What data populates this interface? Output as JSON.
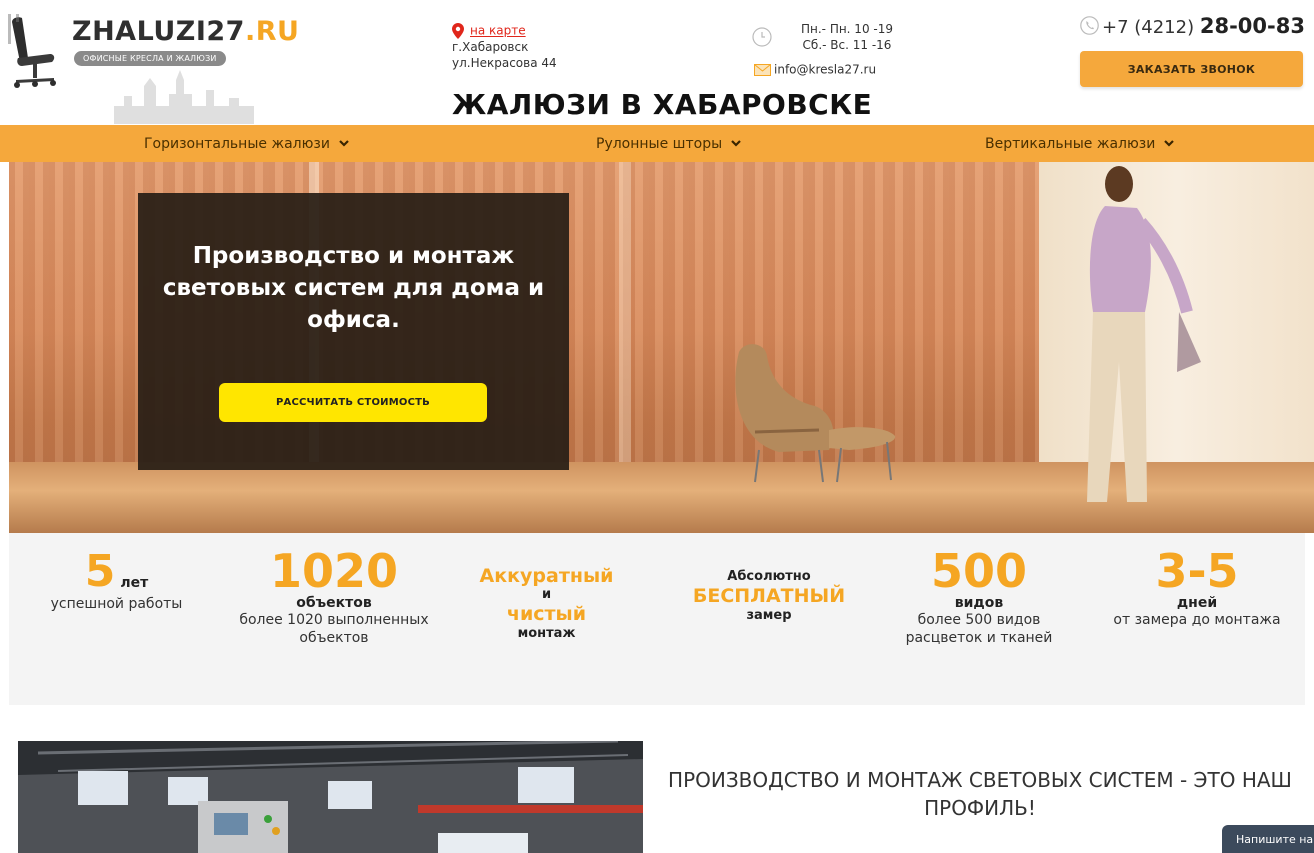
{
  "header": {
    "brand_main": "ZHALUZI27",
    "brand_tld": ".RU",
    "tagline": "ОФИСНЫЕ КРЕСЛА И ЖАЛЮЗИ",
    "map_link": "на карте",
    "address_city": "г.Хабаровск",
    "address_street": "ул.Некрасова 44",
    "hours_weekdays": "Пн.- Пн. 10 -19",
    "hours_weekend": "Сб.- Вс. 11 -16",
    "email": "info@kresla27.ru",
    "phone_prefix": "+7 (4212)",
    "phone_number": "28-00-83",
    "callback_label": "ЗАКАЗАТЬ ЗВОНОК",
    "page_title": "ЖАЛЮЗИ В ХАБАРОВСКЕ"
  },
  "nav": {
    "items": [
      {
        "label": "Горизонтальные жалюзи"
      },
      {
        "label": "Рулонные шторы"
      },
      {
        "label": "Вертикальные жалюзи"
      }
    ]
  },
  "hero": {
    "heading": "Производство и монтаж световых систем для дома и офиса.",
    "cta_label": "РАССЧИТАТЬ СТОИМОСТЬ"
  },
  "stats": {
    "years_number": "5",
    "years_unit": "лет",
    "years_desc": "успешной работы",
    "objects_number": "1020",
    "objects_unit": "объектов",
    "objects_desc": "более 1020 выполненных объектов",
    "accurate_1": "Аккуратный",
    "accurate_and": "и",
    "accurate_2": "чистый",
    "accurate_3": "монтаж",
    "free_1": "Абсолютно",
    "free_2": "БЕСПЛАТНЫЙ",
    "free_3": "замер",
    "kinds_number": "500",
    "kinds_unit": "видов",
    "kinds_desc": "более 500 видов расцветок и тканей",
    "days_number": "3-5",
    "days_unit": "дней",
    "days_desc": "от замера до монтажа"
  },
  "section": {
    "profile_heading": "ПРОИЗВОДСТВО И МОНТАЖ СВЕТОВЫХ СИСТЕМ - ЭТО НАШ ПРОФИЛЬ!"
  },
  "chat": {
    "label": "Напишите нам"
  },
  "colors": {
    "accent": "#f5a83c",
    "brand_orange": "#f5a623",
    "cta_yellow": "#ffe600",
    "map_red": "#e0261b"
  },
  "icons": [
    "chair-logo-icon",
    "map-pin-icon",
    "clock-icon",
    "envelope-icon",
    "phone-icon",
    "chevron-down-icon"
  ]
}
